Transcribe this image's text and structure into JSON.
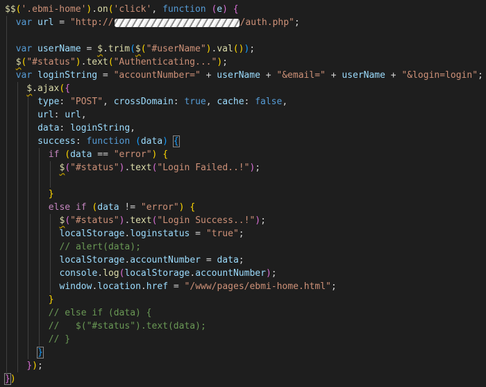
{
  "editor": {
    "theme": {
      "background": "#1e1e1e",
      "default": "#d4d4d4",
      "keyword": "#569cd6",
      "control": "#c586c0",
      "variable": "#9cdcfe",
      "function": "#dcdcaa",
      "string": "#ce9178",
      "comment": "#6a9955",
      "bracket_gold": "#ffd700",
      "bracket_purple": "#da70d6",
      "bracket_blue": "#179fff"
    },
    "lines": [
      {
        "indent": 0,
        "tokens": [
          [
            "$$",
            "fn"
          ],
          [
            "(",
            "gold"
          ],
          [
            "'.ebmi-home'",
            "str"
          ],
          [
            ")",
            "gold"
          ],
          [
            ".",
            "p"
          ],
          [
            "on",
            "fn"
          ],
          [
            "(",
            "gold"
          ],
          [
            "'click'",
            "str"
          ],
          [
            ", ",
            "p"
          ],
          [
            "function",
            "kw"
          ],
          [
            " ",
            "p"
          ],
          [
            "(",
            "purple"
          ],
          [
            "e",
            "var"
          ],
          [
            ")",
            "purple"
          ],
          [
            " ",
            "p"
          ],
          [
            "{",
            "purple"
          ]
        ]
      },
      {
        "indent": 1,
        "tokens": [
          [
            "var",
            "kw"
          ],
          [
            " ",
            "p"
          ],
          [
            "url",
            "var"
          ],
          [
            " = ",
            "p"
          ],
          [
            "\"http://",
            "str"
          ],
          [
            "REDACTED",
            "redact"
          ],
          [
            "/auth.php\"",
            "str"
          ],
          [
            ";",
            "p"
          ]
        ]
      },
      {
        "indent": 1,
        "tokens": []
      },
      {
        "indent": 1,
        "tokens": [
          [
            "var",
            "kw"
          ],
          [
            " ",
            "p"
          ],
          [
            "userName",
            "var"
          ],
          [
            " = ",
            "p"
          ],
          [
            "$",
            "fn-sq"
          ],
          [
            ".",
            "p"
          ],
          [
            "trim",
            "fn"
          ],
          [
            "(",
            "blue"
          ],
          [
            "$",
            "fn-sq"
          ],
          [
            "(",
            "gold"
          ],
          [
            "\"#userName\"",
            "str"
          ],
          [
            ")",
            "gold"
          ],
          [
            ".",
            "p"
          ],
          [
            "val",
            "fn"
          ],
          [
            "(",
            "gold"
          ],
          [
            ")",
            "gold"
          ],
          [
            ")",
            "blue"
          ],
          [
            ";",
            "p"
          ]
        ]
      },
      {
        "indent": 1,
        "tokens": [
          [
            "$",
            "fn-sq"
          ],
          [
            "(",
            "gold"
          ],
          [
            "\"#status\"",
            "str"
          ],
          [
            ")",
            "gold"
          ],
          [
            ".",
            "p"
          ],
          [
            "text",
            "fn"
          ],
          [
            "(",
            "gold"
          ],
          [
            "\"Authenticating...\"",
            "str"
          ],
          [
            ")",
            "gold"
          ],
          [
            ";",
            "p"
          ]
        ]
      },
      {
        "indent": 1,
        "tokens": [
          [
            "var",
            "kw"
          ],
          [
            " ",
            "p"
          ],
          [
            "loginString",
            "var"
          ],
          [
            " = ",
            "p"
          ],
          [
            "\"accountNumber=\"",
            "str"
          ],
          [
            " + ",
            "p"
          ],
          [
            "userName",
            "var"
          ],
          [
            " + ",
            "p"
          ],
          [
            "\"&email=\"",
            "str"
          ],
          [
            " + ",
            "p"
          ],
          [
            "userName",
            "var"
          ],
          [
            " + ",
            "p"
          ],
          [
            "\"&login=login\"",
            "str"
          ],
          [
            ";",
            "p"
          ]
        ]
      },
      {
        "indent": 2,
        "tokens": [
          [
            "$",
            "fn-sq"
          ],
          [
            ".",
            "p"
          ],
          [
            "ajax",
            "fn"
          ],
          [
            "(",
            "gold"
          ],
          [
            "{",
            "purple"
          ]
        ]
      },
      {
        "indent": 3,
        "tokens": [
          [
            "type",
            "var"
          ],
          [
            ": ",
            "p"
          ],
          [
            "\"POST\"",
            "str"
          ],
          [
            ", ",
            "p"
          ],
          [
            "crossDomain",
            "var"
          ],
          [
            ": ",
            "p"
          ],
          [
            "true",
            "kw"
          ],
          [
            ", ",
            "p"
          ],
          [
            "cache",
            "var"
          ],
          [
            ": ",
            "p"
          ],
          [
            "false",
            "kw"
          ],
          [
            ",",
            "p"
          ]
        ]
      },
      {
        "indent": 3,
        "tokens": [
          [
            "url",
            "var"
          ],
          [
            ": ",
            "p"
          ],
          [
            "url",
            "var"
          ],
          [
            ",",
            "p"
          ]
        ]
      },
      {
        "indent": 3,
        "tokens": [
          [
            "data",
            "var"
          ],
          [
            ": ",
            "p"
          ],
          [
            "loginString",
            "var"
          ],
          [
            ",",
            "p"
          ]
        ]
      },
      {
        "indent": 3,
        "tokens": [
          [
            "success",
            "var"
          ],
          [
            ": ",
            "p"
          ],
          [
            "function",
            "kw"
          ],
          [
            " ",
            "p"
          ],
          [
            "(",
            "blue"
          ],
          [
            "data",
            "var"
          ],
          [
            ")",
            "blue"
          ],
          [
            " ",
            "p"
          ],
          [
            "{",
            "blue-box"
          ]
        ]
      },
      {
        "indent": 4,
        "tokens": [
          [
            "if",
            "ctl"
          ],
          [
            " ",
            "p"
          ],
          [
            "(",
            "gold"
          ],
          [
            "data",
            "var"
          ],
          [
            " == ",
            "p"
          ],
          [
            "\"error\"",
            "str"
          ],
          [
            ")",
            "gold"
          ],
          [
            " ",
            "p"
          ],
          [
            "{",
            "gold"
          ]
        ]
      },
      {
        "indent": 5,
        "tokens": [
          [
            "$",
            "fn-sq"
          ],
          [
            "(",
            "purple"
          ],
          [
            "\"#status\"",
            "str"
          ],
          [
            ")",
            "purple"
          ],
          [
            ".",
            "p"
          ],
          [
            "text",
            "fn"
          ],
          [
            "(",
            "purple"
          ],
          [
            "\"Login Failed..!\"",
            "str"
          ],
          [
            ")",
            "purple"
          ],
          [
            ";",
            "p"
          ]
        ]
      },
      {
        "indent": 5,
        "tokens": []
      },
      {
        "indent": 4,
        "tokens": [
          [
            "}",
            "gold"
          ]
        ]
      },
      {
        "indent": 4,
        "tokens": [
          [
            "else",
            "ctl"
          ],
          [
            " ",
            "p"
          ],
          [
            "if",
            "ctl"
          ],
          [
            " ",
            "p"
          ],
          [
            "(",
            "gold"
          ],
          [
            "data",
            "var"
          ],
          [
            " != ",
            "p"
          ],
          [
            "\"error\"",
            "str"
          ],
          [
            ")",
            "gold"
          ],
          [
            " ",
            "p"
          ],
          [
            "{",
            "gold"
          ]
        ]
      },
      {
        "indent": 5,
        "tokens": [
          [
            "$",
            "fn-sq"
          ],
          [
            "(",
            "purple"
          ],
          [
            "\"#status\"",
            "str"
          ],
          [
            ")",
            "purple"
          ],
          [
            ".",
            "p"
          ],
          [
            "text",
            "fn"
          ],
          [
            "(",
            "purple"
          ],
          [
            "\"Login Success..!\"",
            "str"
          ],
          [
            ")",
            "purple"
          ],
          [
            ";",
            "p"
          ]
        ]
      },
      {
        "indent": 5,
        "tokens": [
          [
            "localStorage",
            "var"
          ],
          [
            ".",
            "p"
          ],
          [
            "loginstatus",
            "var"
          ],
          [
            " = ",
            "p"
          ],
          [
            "\"true\"",
            "str"
          ],
          [
            ";",
            "p"
          ]
        ]
      },
      {
        "indent": 5,
        "tokens": [
          [
            "// alert(data);",
            "cmt"
          ]
        ]
      },
      {
        "indent": 5,
        "tokens": [
          [
            "localStorage",
            "var"
          ],
          [
            ".",
            "p"
          ],
          [
            "accountNumber",
            "var"
          ],
          [
            " = ",
            "p"
          ],
          [
            "data",
            "var"
          ],
          [
            ";",
            "p"
          ]
        ]
      },
      {
        "indent": 5,
        "tokens": [
          [
            "console",
            "var"
          ],
          [
            ".",
            "p"
          ],
          [
            "log",
            "fn"
          ],
          [
            "(",
            "purple"
          ],
          [
            "localStorage",
            "var"
          ],
          [
            ".",
            "p"
          ],
          [
            "accountNumber",
            "var"
          ],
          [
            ")",
            "purple"
          ],
          [
            ";",
            "p"
          ]
        ]
      },
      {
        "indent": 5,
        "tokens": [
          [
            "window",
            "var"
          ],
          [
            ".",
            "p"
          ],
          [
            "location",
            "var"
          ],
          [
            ".",
            "p"
          ],
          [
            "href",
            "var"
          ],
          [
            " = ",
            "p"
          ],
          [
            "\"/www/pages/ebmi-home.html\"",
            "str"
          ],
          [
            ";",
            "p"
          ]
        ]
      },
      {
        "indent": 4,
        "tokens": [
          [
            "}",
            "gold"
          ]
        ]
      },
      {
        "indent": 4,
        "tokens": [
          [
            "// else if (data) {",
            "cmt"
          ]
        ]
      },
      {
        "indent": 4,
        "tokens": [
          [
            "//   $(\"#status\").text(data);",
            "cmt"
          ]
        ]
      },
      {
        "indent": 4,
        "tokens": [
          [
            "// }",
            "cmt"
          ]
        ]
      },
      {
        "indent": 3,
        "tokens": [
          [
            "}",
            "blue-box"
          ]
        ]
      },
      {
        "indent": 2,
        "tokens": [
          [
            "}",
            "purple"
          ],
          [
            ")",
            "gold"
          ],
          [
            ";",
            "p"
          ]
        ]
      },
      {
        "indent": 0,
        "tokens": [
          [
            "}",
            "purple-box"
          ],
          [
            ")",
            "gold"
          ]
        ]
      }
    ]
  }
}
